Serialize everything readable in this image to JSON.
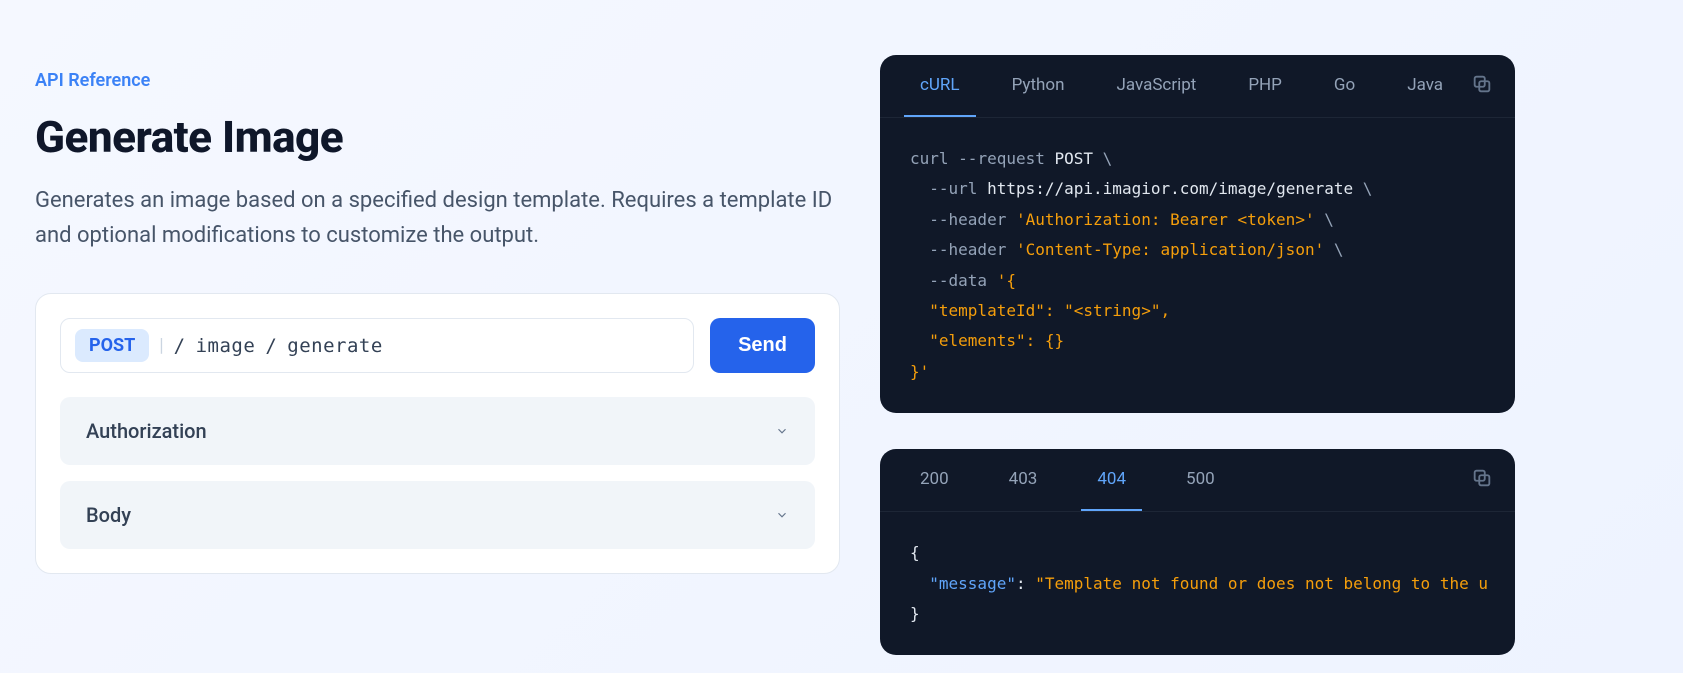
{
  "breadcrumb": "API Reference",
  "page_title": "Generate Image",
  "page_description": "Generates an image based on a specified design template. Requires a template ID and optional modifications to customize the output.",
  "request": {
    "method": "POST",
    "path_segment1": "image",
    "path_segment2": "generate",
    "send_label": "Send",
    "sections": {
      "authorization": "Authorization",
      "body": "Body"
    }
  },
  "code_panel": {
    "tabs": [
      "cURL",
      "Python",
      "JavaScript",
      "PHP",
      "Go",
      "Java"
    ],
    "active_tab": "cURL",
    "code": {
      "line1_cmd": "curl",
      "line1_flag": "--request",
      "line1_method": "POST",
      "line1_cont": " \\",
      "line2_flag": "  --url",
      "line2_url": "https://api.imagior.com/image/generate",
      "line2_cont": " \\",
      "line3_flag": "  --header",
      "line3_val": " 'Authorization: Bearer <token>'",
      "line3_cont": " \\",
      "line4_flag": "  --header",
      "line4_val": " 'Content-Type: application/json'",
      "line4_cont": " \\",
      "line5_flag": "  --data",
      "line5_val": " '{",
      "line6": "  \"templateId\": \"<string>\",",
      "line7": "  \"elements\": {}",
      "line8": "}'"
    }
  },
  "response_panel": {
    "tabs": [
      "200",
      "403",
      "404",
      "500"
    ],
    "active_tab": "404",
    "code": {
      "line1": "{",
      "line2_key": "  \"message\"",
      "line2_colon": ": ",
      "line2_val": "\"Template not found or does not belong to the u",
      "line3": "}"
    }
  }
}
